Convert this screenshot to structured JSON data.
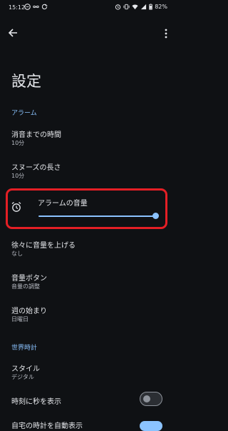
{
  "status_bar": {
    "time": "15:12",
    "battery": "82%",
    "left_icons": [
      "message-icon",
      "infinity-icon",
      "sync-icon"
    ],
    "right_icons": [
      "alarm-icon",
      "vibrate-icon",
      "wifi-icon",
      "signal-icon",
      "battery-icon"
    ]
  },
  "app_bar": {
    "back_icon": "arrow-left-icon",
    "menu_icon": "more-vert-icon"
  },
  "title": "設定",
  "sections": {
    "alarm": "アラーム",
    "world_clock": "世界時計"
  },
  "alarm_items": {
    "silence_after": {
      "title": "消音までの時間",
      "value": "10分"
    },
    "snooze_length": {
      "title": "スヌーズの長さ",
      "value": "10分"
    },
    "alarm_volume": {
      "title": "アラームの音量",
      "level": 1.0
    },
    "gradual_volume": {
      "title": "徐々に音量を上げる",
      "value": "なし"
    },
    "volume_buttons": {
      "title": "音量ボタン",
      "value": "音量の調整"
    },
    "week_start": {
      "title": "週の始まり",
      "value": "日曜日"
    }
  },
  "clock_items": {
    "style": {
      "title": "スタイル",
      "value": "デジタル"
    },
    "show_seconds": {
      "title": "時刻に秒を表示",
      "on": false
    },
    "auto_home_clock": {
      "title": "自宅の時計を自動表示",
      "on": true
    }
  },
  "colors": {
    "accent": "#8bc3ff",
    "highlight": "#e41f25",
    "background": "#0f1114"
  }
}
